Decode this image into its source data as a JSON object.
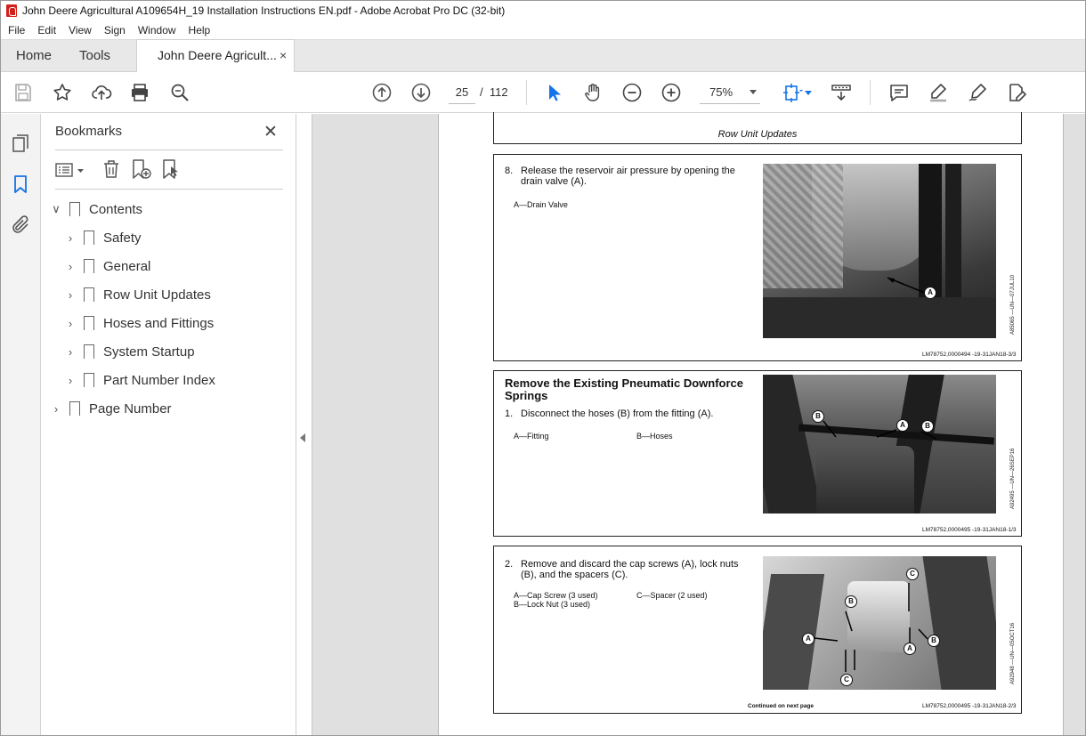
{
  "window": {
    "title": "John Deere Agricultural A109654H_19 Installation Instructions EN.pdf - Adobe Acrobat Pro DC (32-bit)"
  },
  "menu": [
    "File",
    "Edit",
    "View",
    "Sign",
    "Window",
    "Help"
  ],
  "tabs": {
    "home": "Home",
    "tools": "Tools",
    "document": "John Deere Agricult...",
    "close": "×"
  },
  "toolbar": {
    "page_current": "25",
    "page_sep": "/",
    "page_total": "112",
    "zoom": "75%"
  },
  "bookmarks": {
    "title": "Bookmarks",
    "close": "✕",
    "items": [
      {
        "label": "Contents",
        "expanded": true
      },
      {
        "label": "Safety"
      },
      {
        "label": "General"
      },
      {
        "label": "Row Unit Updates"
      },
      {
        "label": "Hoses and Fittings"
      },
      {
        "label": "System Startup"
      },
      {
        "label": "Part Number Index"
      },
      {
        "label": "Page Number"
      }
    ]
  },
  "pdf": {
    "header": "Row Unit Updates",
    "section1": {
      "step": "8.",
      "text": "Release the reservoir air pressure by opening the drain valve (A).",
      "legend": "A—Drain Valve",
      "image_code": "A85065 —UN—07JUL10",
      "footer": "LM78752,0000494 -19-31JAN18-3/3"
    },
    "section2": {
      "heading": "Remove the Existing Pneumatic Downforce Springs",
      "step": "1.",
      "text": "Disconnect the hoses (B) from the fitting (A).",
      "legend_a": "A—Fitting",
      "legend_b": "B—Hoses",
      "image_code": "A92495 —UN—26SEP16",
      "footer": "LM78752,0000495 -19-31JAN18-1/3"
    },
    "section3": {
      "step": "2.",
      "text": "Remove and discard the cap screws (A), lock nuts (B), and the spacers (C).",
      "legend_a": "A—Cap Screw (3 used)",
      "legend_b": "B—Lock Nut (3 used)",
      "legend_c": "C—Spacer (2 used)",
      "image_code": "A92948 —UN—05OCT16",
      "continued": "Continued on next page",
      "footer": "LM78752,0000495 -19-31JAN18-2/3"
    },
    "callouts": {
      "a": "A",
      "b": "B",
      "c": "C"
    }
  }
}
